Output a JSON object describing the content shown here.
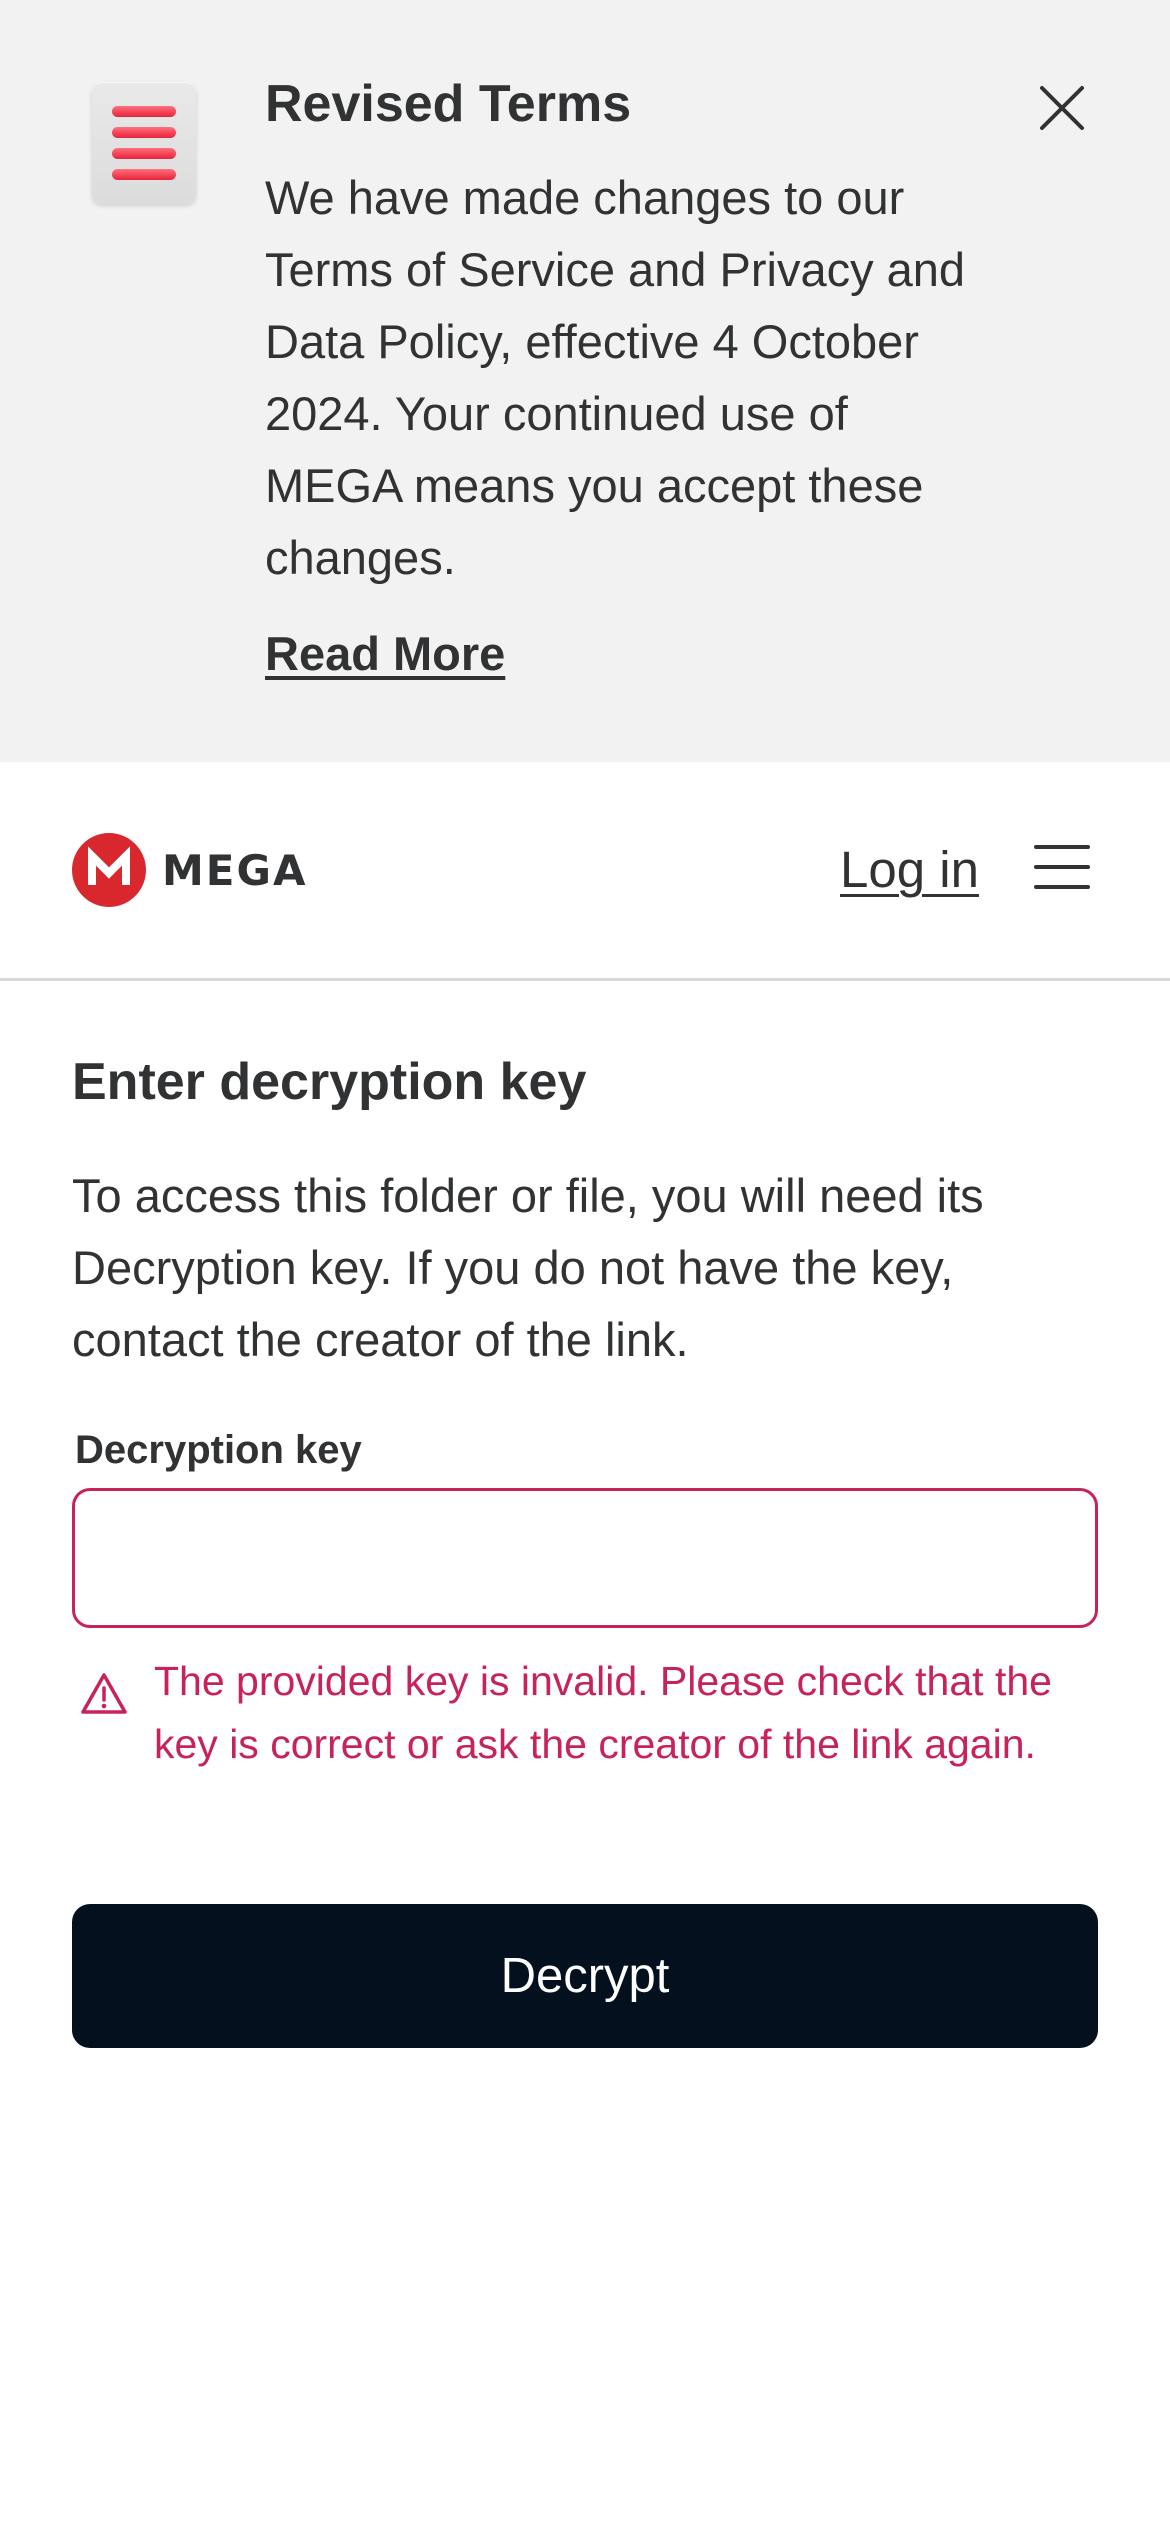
{
  "banner": {
    "title": "Revised Terms",
    "body": "We have made changes to our Terms of Service and Privacy and Data Policy, effective 4 October 2024. Your continued use of MEGA means you accept these changes.",
    "read_more": "Read More",
    "icon": "document-lines-icon",
    "close_icon": "close-icon"
  },
  "header": {
    "logo_text": "MEGA",
    "logo_letter": "M",
    "login_label": "Log in",
    "menu_icon": "hamburger-menu-icon"
  },
  "main": {
    "title": "Enter decryption key",
    "description": "To access this folder or file, you will need its Decryption key. If you do not have the key, contact the creator of the link.",
    "field_label": "Decryption key",
    "input_value": "",
    "input_placeholder": "",
    "error_icon": "warning-icon",
    "error_message": "The provided key is invalid. Please check that the key is correct or ask the creator of the link again.",
    "decrypt_label": "Decrypt"
  },
  "colors": {
    "brand_red": "#d9272e",
    "error": "#c7225a",
    "button_bg": "#04101e",
    "banner_bg": "#f2f2f2",
    "text": "#303233"
  }
}
